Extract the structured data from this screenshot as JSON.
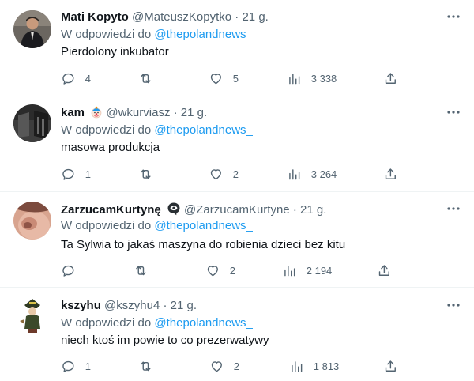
{
  "reply_prefix": "W odpowiedzi do",
  "tweets": [
    {
      "name": "Mati Kopyto",
      "handle": "@MateuszKopytko",
      "separator": "·",
      "time": "21 g.",
      "reply_to": "@thepolandnews_",
      "text": "Pierdolony inkubator",
      "replies": "4",
      "retweets": "",
      "likes": "5",
      "views": "3 338"
    },
    {
      "name": "kam",
      "handle": "@wkurviasz",
      "separator": "·",
      "time": "21 g.",
      "reply_to": "@thepolandnews_",
      "text": "masowa produkcja",
      "replies": "1",
      "retweets": "",
      "likes": "2",
      "views": "3 264"
    },
    {
      "name": "ZarzucamKurtynę",
      "handle": "@ZarzucamKurtyne",
      "separator": "·",
      "time": "21 g.",
      "reply_to": "@thepolandnews_",
      "text": "Ta Sylwia to jakaś maszyna do robienia dzieci bez kitu",
      "replies": "",
      "retweets": "",
      "likes": "2",
      "views": "2 194"
    },
    {
      "name": "kszyhu",
      "handle": "@kszyhu4",
      "separator": "·",
      "time": "21 g.",
      "reply_to": "@thepolandnews_",
      "text": "niech ktoś im powie to co prezerwatywy",
      "replies": "1",
      "retweets": "",
      "likes": "2",
      "views": "1 813"
    }
  ],
  "colors": {
    "text": "#0f1419",
    "secondary": "#536471",
    "link": "#1d9bf0",
    "divider": "#eff3f4"
  }
}
